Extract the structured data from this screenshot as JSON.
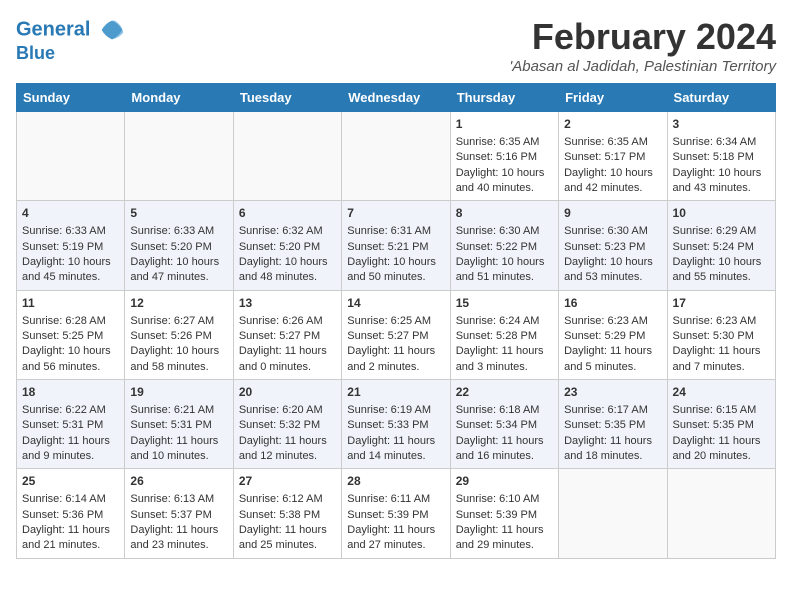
{
  "logo": {
    "line1": "General",
    "line2": "Blue"
  },
  "title": "February 2024",
  "subtitle": "'Abasan al Jadidah, Palestinian Territory",
  "headers": [
    "Sunday",
    "Monday",
    "Tuesday",
    "Wednesday",
    "Thursday",
    "Friday",
    "Saturday"
  ],
  "weeks": [
    [
      {
        "day": "",
        "info": ""
      },
      {
        "day": "",
        "info": ""
      },
      {
        "day": "",
        "info": ""
      },
      {
        "day": "",
        "info": ""
      },
      {
        "day": "1",
        "info": "Sunrise: 6:35 AM\nSunset: 5:16 PM\nDaylight: 10 hours\nand 40 minutes."
      },
      {
        "day": "2",
        "info": "Sunrise: 6:35 AM\nSunset: 5:17 PM\nDaylight: 10 hours\nand 42 minutes."
      },
      {
        "day": "3",
        "info": "Sunrise: 6:34 AM\nSunset: 5:18 PM\nDaylight: 10 hours\nand 43 minutes."
      }
    ],
    [
      {
        "day": "4",
        "info": "Sunrise: 6:33 AM\nSunset: 5:19 PM\nDaylight: 10 hours\nand 45 minutes."
      },
      {
        "day": "5",
        "info": "Sunrise: 6:33 AM\nSunset: 5:20 PM\nDaylight: 10 hours\nand 47 minutes."
      },
      {
        "day": "6",
        "info": "Sunrise: 6:32 AM\nSunset: 5:20 PM\nDaylight: 10 hours\nand 48 minutes."
      },
      {
        "day": "7",
        "info": "Sunrise: 6:31 AM\nSunset: 5:21 PM\nDaylight: 10 hours\nand 50 minutes."
      },
      {
        "day": "8",
        "info": "Sunrise: 6:30 AM\nSunset: 5:22 PM\nDaylight: 10 hours\nand 51 minutes."
      },
      {
        "day": "9",
        "info": "Sunrise: 6:30 AM\nSunset: 5:23 PM\nDaylight: 10 hours\nand 53 minutes."
      },
      {
        "day": "10",
        "info": "Sunrise: 6:29 AM\nSunset: 5:24 PM\nDaylight: 10 hours\nand 55 minutes."
      }
    ],
    [
      {
        "day": "11",
        "info": "Sunrise: 6:28 AM\nSunset: 5:25 PM\nDaylight: 10 hours\nand 56 minutes."
      },
      {
        "day": "12",
        "info": "Sunrise: 6:27 AM\nSunset: 5:26 PM\nDaylight: 10 hours\nand 58 minutes."
      },
      {
        "day": "13",
        "info": "Sunrise: 6:26 AM\nSunset: 5:27 PM\nDaylight: 11 hours\nand 0 minutes."
      },
      {
        "day": "14",
        "info": "Sunrise: 6:25 AM\nSunset: 5:27 PM\nDaylight: 11 hours\nand 2 minutes."
      },
      {
        "day": "15",
        "info": "Sunrise: 6:24 AM\nSunset: 5:28 PM\nDaylight: 11 hours\nand 3 minutes."
      },
      {
        "day": "16",
        "info": "Sunrise: 6:23 AM\nSunset: 5:29 PM\nDaylight: 11 hours\nand 5 minutes."
      },
      {
        "day": "17",
        "info": "Sunrise: 6:23 AM\nSunset: 5:30 PM\nDaylight: 11 hours\nand 7 minutes."
      }
    ],
    [
      {
        "day": "18",
        "info": "Sunrise: 6:22 AM\nSunset: 5:31 PM\nDaylight: 11 hours\nand 9 minutes."
      },
      {
        "day": "19",
        "info": "Sunrise: 6:21 AM\nSunset: 5:31 PM\nDaylight: 11 hours\nand 10 minutes."
      },
      {
        "day": "20",
        "info": "Sunrise: 6:20 AM\nSunset: 5:32 PM\nDaylight: 11 hours\nand 12 minutes."
      },
      {
        "day": "21",
        "info": "Sunrise: 6:19 AM\nSunset: 5:33 PM\nDaylight: 11 hours\nand 14 minutes."
      },
      {
        "day": "22",
        "info": "Sunrise: 6:18 AM\nSunset: 5:34 PM\nDaylight: 11 hours\nand 16 minutes."
      },
      {
        "day": "23",
        "info": "Sunrise: 6:17 AM\nSunset: 5:35 PM\nDaylight: 11 hours\nand 18 minutes."
      },
      {
        "day": "24",
        "info": "Sunrise: 6:15 AM\nSunset: 5:35 PM\nDaylight: 11 hours\nand 20 minutes."
      }
    ],
    [
      {
        "day": "25",
        "info": "Sunrise: 6:14 AM\nSunset: 5:36 PM\nDaylight: 11 hours\nand 21 minutes."
      },
      {
        "day": "26",
        "info": "Sunrise: 6:13 AM\nSunset: 5:37 PM\nDaylight: 11 hours\nand 23 minutes."
      },
      {
        "day": "27",
        "info": "Sunrise: 6:12 AM\nSunset: 5:38 PM\nDaylight: 11 hours\nand 25 minutes."
      },
      {
        "day": "28",
        "info": "Sunrise: 6:11 AM\nSunset: 5:39 PM\nDaylight: 11 hours\nand 27 minutes."
      },
      {
        "day": "29",
        "info": "Sunrise: 6:10 AM\nSunset: 5:39 PM\nDaylight: 11 hours\nand 29 minutes."
      },
      {
        "day": "",
        "info": ""
      },
      {
        "day": "",
        "info": ""
      }
    ]
  ]
}
